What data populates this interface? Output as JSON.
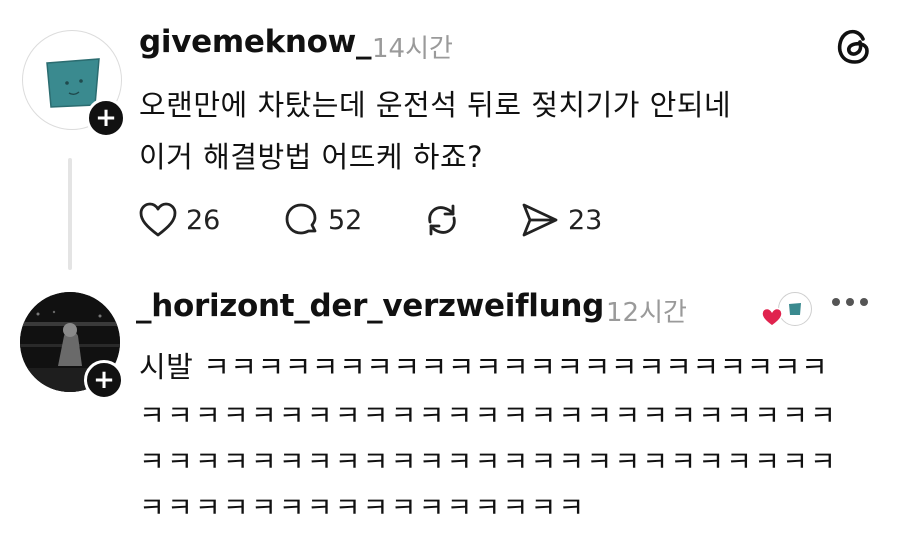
{
  "icons": {
    "threads_logo": "threads-logo-icon",
    "like": "heart-icon",
    "reply": "comment-bubble-icon",
    "repost": "repost-icon",
    "share": "send-icon",
    "more": "more-dots-icon",
    "follow": "plus-icon"
  },
  "colors": {
    "teal_avatar": "#3a8a8f",
    "liked_heart": "#e0234e",
    "timestamp": "#9a9a9a"
  },
  "post": {
    "username": "givemeknow_",
    "timestamp": "14시간",
    "follow_glyph": "+",
    "lines": [
      "오랜만에 차탔는데 운전석 뒤로 젖치기가 안되네",
      "이거 해결방법 어뜨케 하죠?"
    ],
    "actions": {
      "likes": "26",
      "replies": "52",
      "shares": "23"
    }
  },
  "reply": {
    "username": "_horizont_der_verzweiflung",
    "timestamp": "12시간",
    "follow_glyph": "+",
    "lines": [
      "시발 ㅋㅋㅋㅋㅋㅋㅋㅋㅋㅋㅋㅋㅋㅋㅋㅋㅋㅋㅋㅋㅋㅋㅋ",
      "ㅋㅋㅋㅋㅋㅋㅋㅋㅋㅋㅋㅋㅋㅋㅋㅋㅋㅋㅋㅋㅋㅋㅋㅋㅋ",
      "ㅋㅋㅋㅋㅋㅋㅋㅋㅋㅋㅋㅋㅋㅋㅋㅋㅋㅋㅋㅋㅋㅋㅋㅋㅋ",
      "ㅋㅋㅋㅋㅋㅋㅋㅋㅋㅋㅋㅋㅋㅋㅋㅋ"
    ]
  }
}
